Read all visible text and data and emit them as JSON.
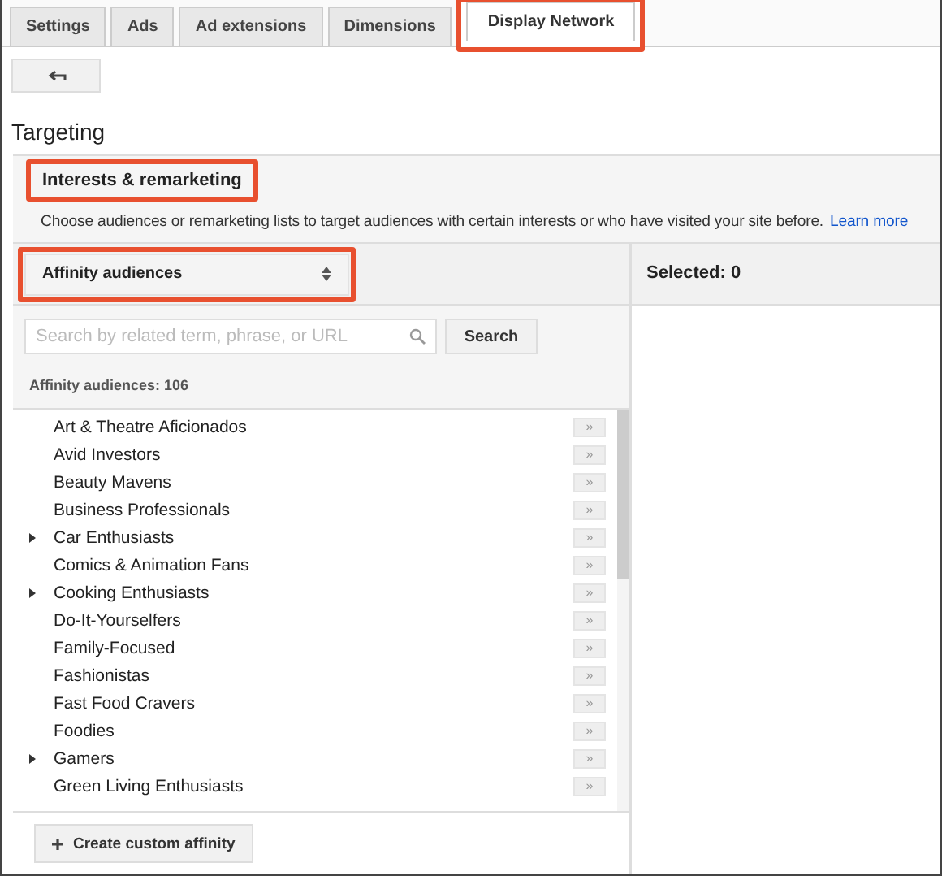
{
  "tabs": [
    {
      "label": "Settings",
      "selected": false,
      "highlighted": false
    },
    {
      "label": "Ads",
      "selected": false,
      "highlighted": false
    },
    {
      "label": "Ad extensions",
      "selected": false,
      "highlighted": false
    },
    {
      "label": "Dimensions",
      "selected": false,
      "highlighted": false
    },
    {
      "label": "Display Network",
      "selected": true,
      "highlighted": true
    }
  ],
  "section_title": "Targeting",
  "panel": {
    "title": "Interests & remarketing",
    "title_highlighted": true,
    "description": "Choose audiences or remarketing lists to target audiences with certain interests or who have visited your site before.",
    "link": "Learn more"
  },
  "dropdown": {
    "value": "Affinity audiences",
    "highlighted": true
  },
  "search": {
    "placeholder": "Search by related term, phrase, or URL",
    "button": "Search"
  },
  "list_header": "Affinity audiences: 106",
  "audiences": [
    {
      "name": "Art & Theatre Aficionados",
      "expandable": false
    },
    {
      "name": "Avid Investors",
      "expandable": false
    },
    {
      "name": "Beauty Mavens",
      "expandable": false
    },
    {
      "name": "Business Professionals",
      "expandable": false
    },
    {
      "name": "Car Enthusiasts",
      "expandable": true
    },
    {
      "name": "Comics & Animation Fans",
      "expandable": false
    },
    {
      "name": "Cooking Enthusiasts",
      "expandable": true
    },
    {
      "name": "Do-It-Yourselfers",
      "expandable": false
    },
    {
      "name": "Family-Focused",
      "expandable": false
    },
    {
      "name": "Fashionistas",
      "expandable": false
    },
    {
      "name": "Fast Food Cravers",
      "expandable": false
    },
    {
      "name": "Foodies",
      "expandable": false
    },
    {
      "name": "Gamers",
      "expandable": true
    },
    {
      "name": "Green Living Enthusiasts",
      "expandable": false
    }
  ],
  "add_button_label": "»",
  "create_button": "Create custom affinity",
  "selected_header": "Selected: 0"
}
